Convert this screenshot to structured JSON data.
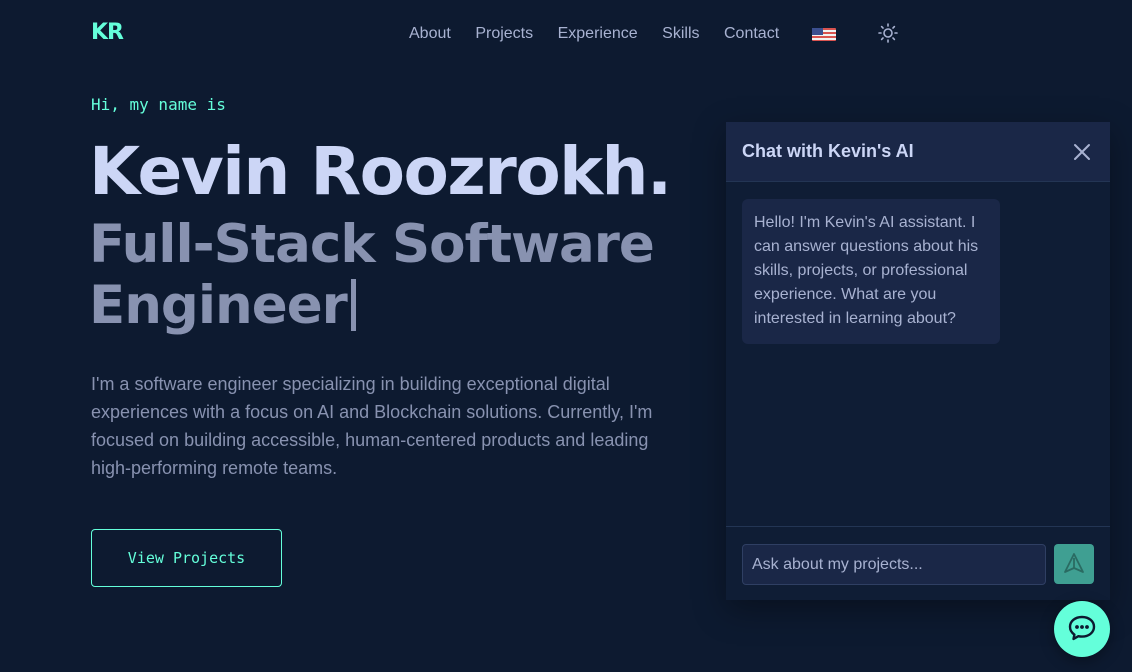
{
  "header": {
    "logo": "KR",
    "nav": [
      "About",
      "Projects",
      "Experience",
      "Skills",
      "Contact"
    ],
    "language_icon": "us-flag-icon",
    "theme_icon": "sun-icon"
  },
  "hero": {
    "greeting": "Hi, my name is",
    "name": "Kevin Roozrokh.",
    "role": "Full-Stack Software Engineer",
    "bio": "I'm a software engineer specializing in building exceptional digital experiences with a focus on AI and Blockchain solutions. Currently, I'm focused on building accessible, human-centered products and leading high-performing remote teams.",
    "cta": "View Projects"
  },
  "chat": {
    "title": "Chat with Kevin's AI",
    "message": "Hello! I'm Kevin's AI assistant. I can answer questions about his skills, projects, or professional experience. What are you interested in learning about?",
    "input_placeholder": "Ask about my projects...",
    "input_value": ""
  },
  "colors": {
    "background": "#0d1a30",
    "accent": "#64ffda",
    "heading": "#ccd6f6",
    "text": "#8892b0"
  }
}
